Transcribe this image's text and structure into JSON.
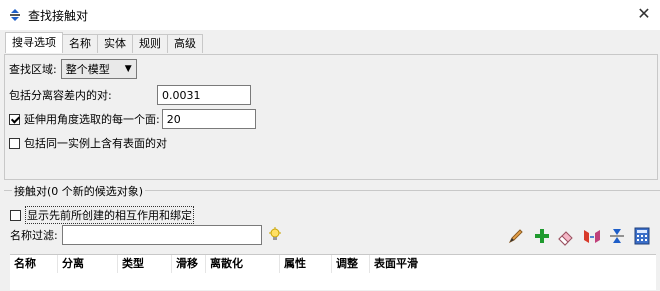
{
  "window": {
    "title": "查找接触对",
    "icon": "search-pair-icon"
  },
  "tabs": [
    {
      "label": "搜寻选项",
      "active": true
    },
    {
      "label": "名称",
      "active": false
    },
    {
      "label": "实体",
      "active": false
    },
    {
      "label": "规则",
      "active": false
    },
    {
      "label": "高级",
      "active": false
    }
  ],
  "search_options": {
    "region_label": "查找区域:",
    "region_value": "整个模型",
    "tolerance_label": "包括分离容差内的对:",
    "tolerance_value": "0.0031",
    "extend_label": "延伸用角度选取的每一个面:",
    "extend_checked": true,
    "extend_value": "20",
    "same_instance_label": "包括同一实例上含有表面的对",
    "same_instance_checked": false
  },
  "contact_pairs": {
    "title": "接触对(0 个新的候选对象)",
    "show_previous_label": "显示先前所创建的相互作用和绑定",
    "show_previous_checked": false,
    "name_filter_label": "名称过滤:",
    "name_filter_value": "",
    "columns": [
      "名称",
      "分离",
      "类型",
      "滑移",
      "离散化",
      "属性",
      "调整",
      "表面平滑"
    ]
  },
  "colors": {
    "accent": "#1e5ec8",
    "panel_bg": "#f0f0f0",
    "table_bg": "#ffffff"
  }
}
